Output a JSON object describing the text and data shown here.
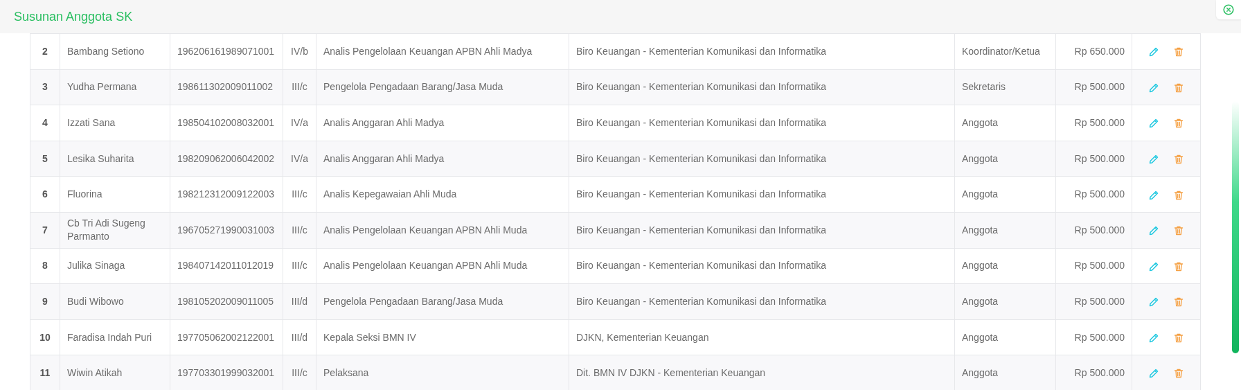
{
  "header": {
    "title": "Susunan Anggota SK"
  },
  "table": {
    "rows": [
      {
        "no": "2",
        "name": "Bambang Setiono",
        "nip": "196206161989071001",
        "golongan": "IV/b",
        "jabatan": "Analis Pengelolaan Keuangan APBN Ahli Madya",
        "instansi": "Biro Keuangan - Kementerian Komunikasi dan Informatika",
        "peran": "Koordinator/Ketua",
        "honor": "Rp 650.000"
      },
      {
        "no": "3",
        "name": "Yudha Permana",
        "nip": "198611302009011002",
        "golongan": "III/c",
        "jabatan": "Pengelola Pengadaan Barang/Jasa Muda",
        "instansi": "Biro Keuangan - Kementerian Komunikasi dan Informatika",
        "peran": "Sekretaris",
        "honor": "Rp 500.000"
      },
      {
        "no": "4",
        "name": "Izzati Sana",
        "nip": "198504102008032001",
        "golongan": "IV/a",
        "jabatan": "Analis Anggaran Ahli Madya",
        "instansi": "Biro Keuangan - Kementerian Komunikasi dan Informatika",
        "peran": "Anggota",
        "honor": "Rp 500.000"
      },
      {
        "no": "5",
        "name": "Lesika Suharita",
        "nip": "198209062006042002",
        "golongan": "IV/a",
        "jabatan": "Analis Anggaran Ahli Madya",
        "instansi": "Biro Keuangan - Kementerian Komunikasi dan Informatika",
        "peran": "Anggota",
        "honor": "Rp 500.000"
      },
      {
        "no": "6",
        "name": "Fluorina",
        "nip": "198212312009122003",
        "golongan": "III/c",
        "jabatan": "Analis Kepegawaian Ahli Muda",
        "instansi": "Biro Keuangan - Kementerian Komunikasi dan Informatika",
        "peran": "Anggota",
        "honor": "Rp 500.000"
      },
      {
        "no": "7",
        "name": "Cb Tri Adi Sugeng Parmanto",
        "nip": "196705271990031003",
        "golongan": "III/c",
        "jabatan": "Analis Pengelolaan Keuangan APBN Ahli Muda",
        "instansi": "Biro Keuangan - Kementerian Komunikasi dan Informatika",
        "peran": "Anggota",
        "honor": "Rp 500.000"
      },
      {
        "no": "8",
        "name": "Julika Sinaga",
        "nip": "198407142011012019",
        "golongan": "III/c",
        "jabatan": "Analis Pengelolaan Keuangan APBN Ahli Muda",
        "instansi": "Biro Keuangan - Kementerian Komunikasi dan Informatika",
        "peran": "Anggota",
        "honor": "Rp 500.000"
      },
      {
        "no": "9",
        "name": "Budi Wibowo",
        "nip": "198105202009011005",
        "golongan": "III/d",
        "jabatan": "Pengelola Pengadaan Barang/Jasa Muda",
        "instansi": "Biro Keuangan - Kementerian Komunikasi dan Informatika",
        "peran": "Anggota",
        "honor": "Rp 500.000"
      },
      {
        "no": "10",
        "name": "Faradisa Indah Puri",
        "nip": "197705062002122001",
        "golongan": "III/d",
        "jabatan": "Kepala Seksi BMN IV",
        "instansi": "DJKN, Kementerian Keuangan",
        "peran": "Anggota",
        "honor": "Rp 500.000"
      },
      {
        "no": "11",
        "name": "Wiwin Atikah",
        "nip": "197703301999032001",
        "golongan": "III/c",
        "jabatan": "Pelaksana",
        "instansi": "Dit. BMN IV DJKN - Kementerian Keuangan",
        "peran": "Anggota",
        "honor": "Rp 500.000"
      }
    ]
  }
}
